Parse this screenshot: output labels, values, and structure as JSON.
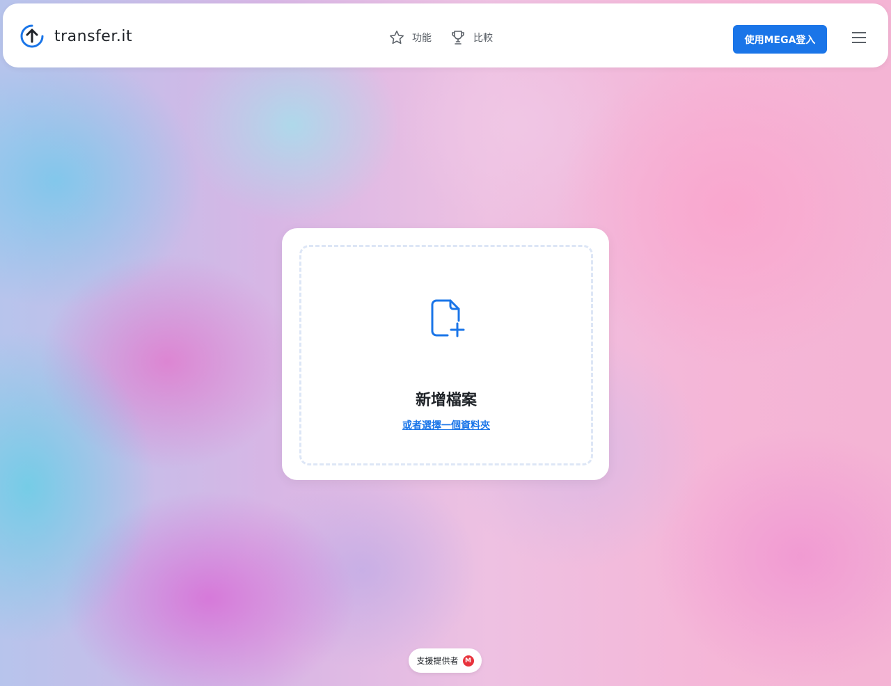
{
  "header": {
    "logo_text": "transfer.it",
    "nav": [
      {
        "label": "功能",
        "icon": "star-icon"
      },
      {
        "label": "比較",
        "icon": "trophy-icon"
      }
    ],
    "login_label": "使用MEGA登入",
    "menu_icon": "hamburger-menu-icon"
  },
  "upload": {
    "icon": "file-add-icon",
    "title": "新增檔案",
    "folder_link": "或者選擇一個資料夾"
  },
  "footer": {
    "powered_by": "支援提供者",
    "badge_letter": "M"
  },
  "colors": {
    "accent": "#1a75e8",
    "mega_red": "#e8333c"
  }
}
